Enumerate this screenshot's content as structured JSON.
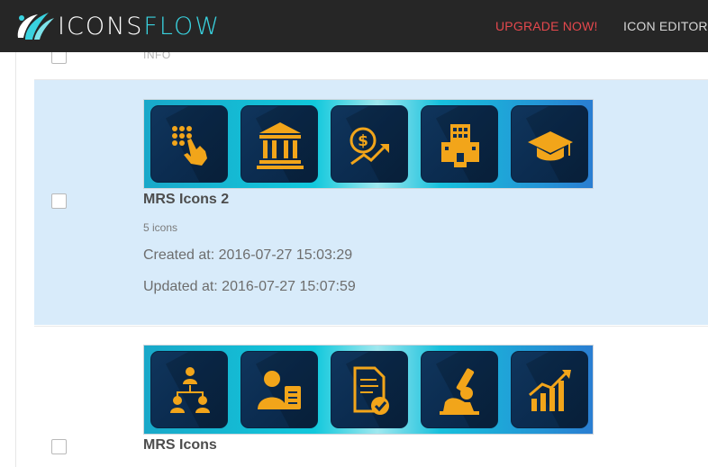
{
  "brand": {
    "icons_text": "ICONS",
    "flow_text": "FLOW",
    "accent": "#39d2df"
  },
  "nav": {
    "upgrade_label": "UPGRADE NOW!",
    "upgrade_color": "#e5484d",
    "editor_label": "ICON EDITOR"
  },
  "list_header": {
    "info_label": "INFO"
  },
  "sets": [
    {
      "title": "MRS Icons 2",
      "count": "5 icons",
      "created": "Created at: 2016-07-27 15:03:29",
      "updated": "Updated at: 2016-07-27 15:07:59",
      "selected": true,
      "icons": [
        "keypad-touch-icon",
        "bank-icon",
        "dollar-growth-icon",
        "hotel-building-icon",
        "graduation-cap-icon"
      ]
    },
    {
      "title": "MRS Icons",
      "selected": false,
      "icons": [
        "team-hierarchy-icon",
        "user-clipboard-icon",
        "document-check-icon",
        "microscope-icon",
        "bar-chart-growth-icon"
      ]
    }
  ],
  "colors": {
    "selected_row": "#d8ebfa",
    "icon_orange": "#f2a51a",
    "tile_navy": "#0b2c50"
  }
}
